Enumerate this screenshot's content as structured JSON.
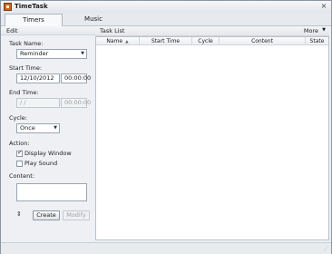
{
  "window": {
    "title": "TimeTask",
    "close_glyph": "×"
  },
  "tabs": [
    {
      "label": "Timers",
      "active": true
    },
    {
      "label": "Music",
      "active": false
    }
  ],
  "edit_panel": {
    "header": "Edit",
    "task_name_label": "Task Name:",
    "task_name_value": "Reminder",
    "start_time_label": "Start Time:",
    "start_date_value": "12/10/2012",
    "start_time_value": "00:00:00",
    "end_time_label": "End Time:",
    "end_date_value": "/  /",
    "end_time_value": "00:00:00",
    "cycle_label": "Cycle:",
    "cycle_value": "Once",
    "action_label": "Action:",
    "display_window_label": "Display Window",
    "display_window_checked": true,
    "play_sound_label": "Play Sound",
    "play_sound_checked": false,
    "content_label": "Content:",
    "content_value": "",
    "updown_glyph": "⇕",
    "create_button": "Create",
    "modify_button": "Modify"
  },
  "task_list": {
    "header": "Task List",
    "more_label": "More",
    "columns": [
      "Name",
      "Start Time",
      "Cycle",
      "Content",
      "State"
    ],
    "sort_glyph": "▲",
    "rows": []
  },
  "colors": {
    "accent": "#c8661f",
    "window_bg": "#eef0f3",
    "list_bg": "#ffffff"
  }
}
